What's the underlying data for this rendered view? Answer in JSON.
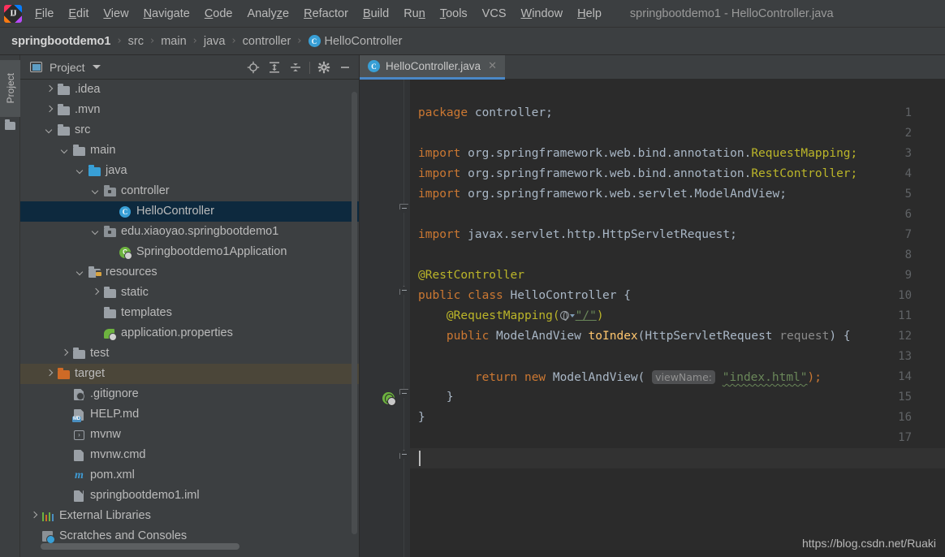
{
  "window": {
    "title": "springbootdemo1 - HelloController.java",
    "logo_icon": "intellij-idea-logo"
  },
  "menubar": {
    "items": [
      {
        "label": "File",
        "mnemonic": "F"
      },
      {
        "label": "Edit",
        "mnemonic": "E"
      },
      {
        "label": "View",
        "mnemonic": "V"
      },
      {
        "label": "Navigate",
        "mnemonic": "N"
      },
      {
        "label": "Code",
        "mnemonic": "C"
      },
      {
        "label": "Analyze",
        "mnemonic": "z"
      },
      {
        "label": "Refactor",
        "mnemonic": "R"
      },
      {
        "label": "Build",
        "mnemonic": "B"
      },
      {
        "label": "Run",
        "mnemonic": "n"
      },
      {
        "label": "Tools",
        "mnemonic": "T"
      },
      {
        "label": "VCS",
        "mnemonic": ""
      },
      {
        "label": "Window",
        "mnemonic": "W"
      },
      {
        "label": "Help",
        "mnemonic": "H"
      }
    ]
  },
  "breadcrumb": {
    "separator": "›",
    "items": [
      {
        "label": "springbootdemo1",
        "icon": "none",
        "root": true
      },
      {
        "label": "src",
        "icon": "none",
        "root": false
      },
      {
        "label": "main",
        "icon": "none",
        "root": false
      },
      {
        "label": "java",
        "icon": "none",
        "root": false
      },
      {
        "label": "controller",
        "icon": "none",
        "root": false
      },
      {
        "label": "HelloController",
        "icon": "class-icon",
        "root": false
      }
    ]
  },
  "toolstripe": {
    "project_label": "Project",
    "folder_icon": "folder-icon"
  },
  "project_panel": {
    "title": "Project",
    "view_icon": "project-view-icon",
    "dropdown_icon": "chevron-down-icon",
    "toolbar": [
      {
        "name": "locate-icon",
        "tooltip": "Select Opened File"
      },
      {
        "name": "expand-all-icon",
        "tooltip": "Expand All"
      },
      {
        "name": "collapse-all-icon",
        "tooltip": "Collapse All"
      },
      {
        "name": "gear-icon",
        "tooltip": "Settings"
      },
      {
        "name": "minimize-icon",
        "tooltip": "Hide"
      }
    ],
    "tree": [
      {
        "label": ".idea",
        "indent": 1,
        "arrow": "right",
        "icon": "folder-gray",
        "state": "normal"
      },
      {
        "label": ".mvn",
        "indent": 1,
        "arrow": "right",
        "icon": "folder-gray",
        "state": "normal"
      },
      {
        "label": "src",
        "indent": 1,
        "arrow": "down",
        "icon": "folder-gray",
        "state": "normal"
      },
      {
        "label": "main",
        "indent": 2,
        "arrow": "down",
        "icon": "folder-gray",
        "state": "normal"
      },
      {
        "label": "java",
        "indent": 3,
        "arrow": "down",
        "icon": "folder-blue",
        "state": "normal"
      },
      {
        "label": "controller",
        "indent": 4,
        "arrow": "down",
        "icon": "folder-package",
        "state": "normal"
      },
      {
        "label": "HelloController",
        "indent": 5,
        "arrow": "none",
        "icon": "class-icon",
        "state": "selected"
      },
      {
        "label": "edu.xiaoyao.springbootdemo1",
        "indent": 4,
        "arrow": "down",
        "icon": "folder-package",
        "state": "normal"
      },
      {
        "label": "Springbootdemo1Application",
        "indent": 5,
        "arrow": "none",
        "icon": "spring-class-icon",
        "state": "normal"
      },
      {
        "label": "resources",
        "indent": 3,
        "arrow": "down",
        "icon": "folder-resource",
        "state": "normal"
      },
      {
        "label": "static",
        "indent": 4,
        "arrow": "right",
        "icon": "folder-gray",
        "state": "normal"
      },
      {
        "label": "templates",
        "indent": 4,
        "arrow": "none",
        "icon": "folder-gray",
        "state": "normal"
      },
      {
        "label": "application.properties",
        "indent": 4,
        "arrow": "none",
        "icon": "spring-leaf-icon",
        "state": "normal"
      },
      {
        "label": "test",
        "indent": 2,
        "arrow": "right",
        "icon": "folder-gray",
        "state": "normal"
      },
      {
        "label": "target",
        "indent": 1,
        "arrow": "right",
        "icon": "folder-orange",
        "state": "hovered"
      },
      {
        "label": ".gitignore",
        "indent": 2,
        "arrow": "none",
        "icon": "gitignore-icon",
        "state": "normal"
      },
      {
        "label": "HELP.md",
        "indent": 2,
        "arrow": "none",
        "icon": "markdown-icon",
        "state": "normal"
      },
      {
        "label": "mvnw",
        "indent": 2,
        "arrow": "none",
        "icon": "shell-icon",
        "state": "normal"
      },
      {
        "label": "mvnw.cmd",
        "indent": 2,
        "arrow": "none",
        "icon": "file-icon",
        "state": "normal"
      },
      {
        "label": "pom.xml",
        "indent": 2,
        "arrow": "none",
        "icon": "maven-icon",
        "state": "normal"
      },
      {
        "label": "springbootdemo1.iml",
        "indent": 2,
        "arrow": "none",
        "icon": "iml-icon",
        "state": "normal"
      },
      {
        "label": "External Libraries",
        "indent": 0,
        "arrow": "right",
        "icon": "library-icon",
        "state": "normal"
      },
      {
        "label": "Scratches and Consoles",
        "indent": 0,
        "arrow": "none",
        "icon": "scratches-icon",
        "state": "normal"
      }
    ]
  },
  "editor": {
    "tab": {
      "label": "HelloController.java",
      "icon": "class-icon",
      "close_icon": "close-icon",
      "active": true
    },
    "lines": [
      {
        "n": 1,
        "text": "package controller;"
      },
      {
        "n": 2,
        "text": ""
      },
      {
        "n": 3,
        "text": "import org.springframework.web.bind.annotation.RequestMapping;"
      },
      {
        "n": 4,
        "text": "import org.springframework.web.bind.annotation.RestController;"
      },
      {
        "n": 5,
        "text": "import org.springframework.web.servlet.ModelAndView;"
      },
      {
        "n": 6,
        "text": ""
      },
      {
        "n": 7,
        "text": "import javax.servlet.http.HttpServletRequest;"
      },
      {
        "n": 8,
        "text": ""
      },
      {
        "n": 9,
        "text": "@RestController"
      },
      {
        "n": 10,
        "text": "public class HelloController {"
      },
      {
        "n": 11,
        "text": "    @RequestMapping(\"/\")"
      },
      {
        "n": 12,
        "text": "    public ModelAndView toIndex(HttpServletRequest request) {"
      },
      {
        "n": 13,
        "text": ""
      },
      {
        "n": 14,
        "text": "        return new ModelAndView( viewName: \"index.html\");"
      },
      {
        "n": 15,
        "text": "    }"
      },
      {
        "n": 16,
        "text": "}"
      },
      {
        "n": 17,
        "text": ""
      }
    ],
    "tokens": {
      "kw_package": "package",
      "package_name": "controller;",
      "kw_import": "import",
      "import3_pkg": " org.springframework.web.bind.annotation.",
      "import3_cls": "RequestMapping;",
      "import4_pkg": " org.springframework.web.bind.annotation.",
      "import4_cls": "RestController;",
      "import5_pkg": " org.springframework.web.servlet.",
      "import5_cls": "ModelAndView;",
      "import7_pkg": " javax.servlet.http.",
      "import7_cls": "HttpServletRequest;",
      "annotation_rest": "@RestController",
      "kw_public": "public",
      "kw_class": "class",
      "class_name": "HelloController",
      "open_brace": "{",
      "annotation_mapping": "@RequestMapping(",
      "mapping_value": "\"/\"",
      "mapping_close": ")",
      "return_type": "ModelAndView",
      "method_name": "toIndex",
      "param_type": "HttpServletRequest",
      "param_name": "request",
      "kw_return": "return",
      "kw_new": "new",
      "ctor_name": "ModelAndView",
      "hint_viewname": "viewName:",
      "string_index": "\"index.html\"",
      "stmt_close": ");",
      "close_brace_inner": "}",
      "close_brace_outer": "}"
    },
    "gutter_icons": [
      {
        "line": 12,
        "name": "web-mapping-globe-icon"
      }
    ],
    "fold_markers": [
      {
        "line": 3,
        "type": "top"
      },
      {
        "line": 7,
        "type": "bottom"
      },
      {
        "line": 12,
        "type": "top"
      },
      {
        "line": 15,
        "type": "bottom"
      }
    ],
    "caret": {
      "line": 17,
      "column": 1
    }
  },
  "watermark": {
    "text": "https://blog.csdn.net/Ruaki"
  },
  "colors": {
    "chrome_bg": "#3c3f41",
    "editor_bg": "#2b2b2b",
    "gutter_bg": "#313335",
    "selection_blue": "#0d293e",
    "hover_brown": "#4b4639",
    "accent_blue": "#4a88c7",
    "keyword_orange": "#cc7832",
    "string_green": "#6a8759",
    "annotation_olive": "#bbb529",
    "method_yellow": "#ffc66d",
    "plain_text": "#a9b7c6",
    "folder_blue": "#389fd6",
    "folder_orange": "#cf6a26",
    "spring_green": "#6db33f"
  }
}
